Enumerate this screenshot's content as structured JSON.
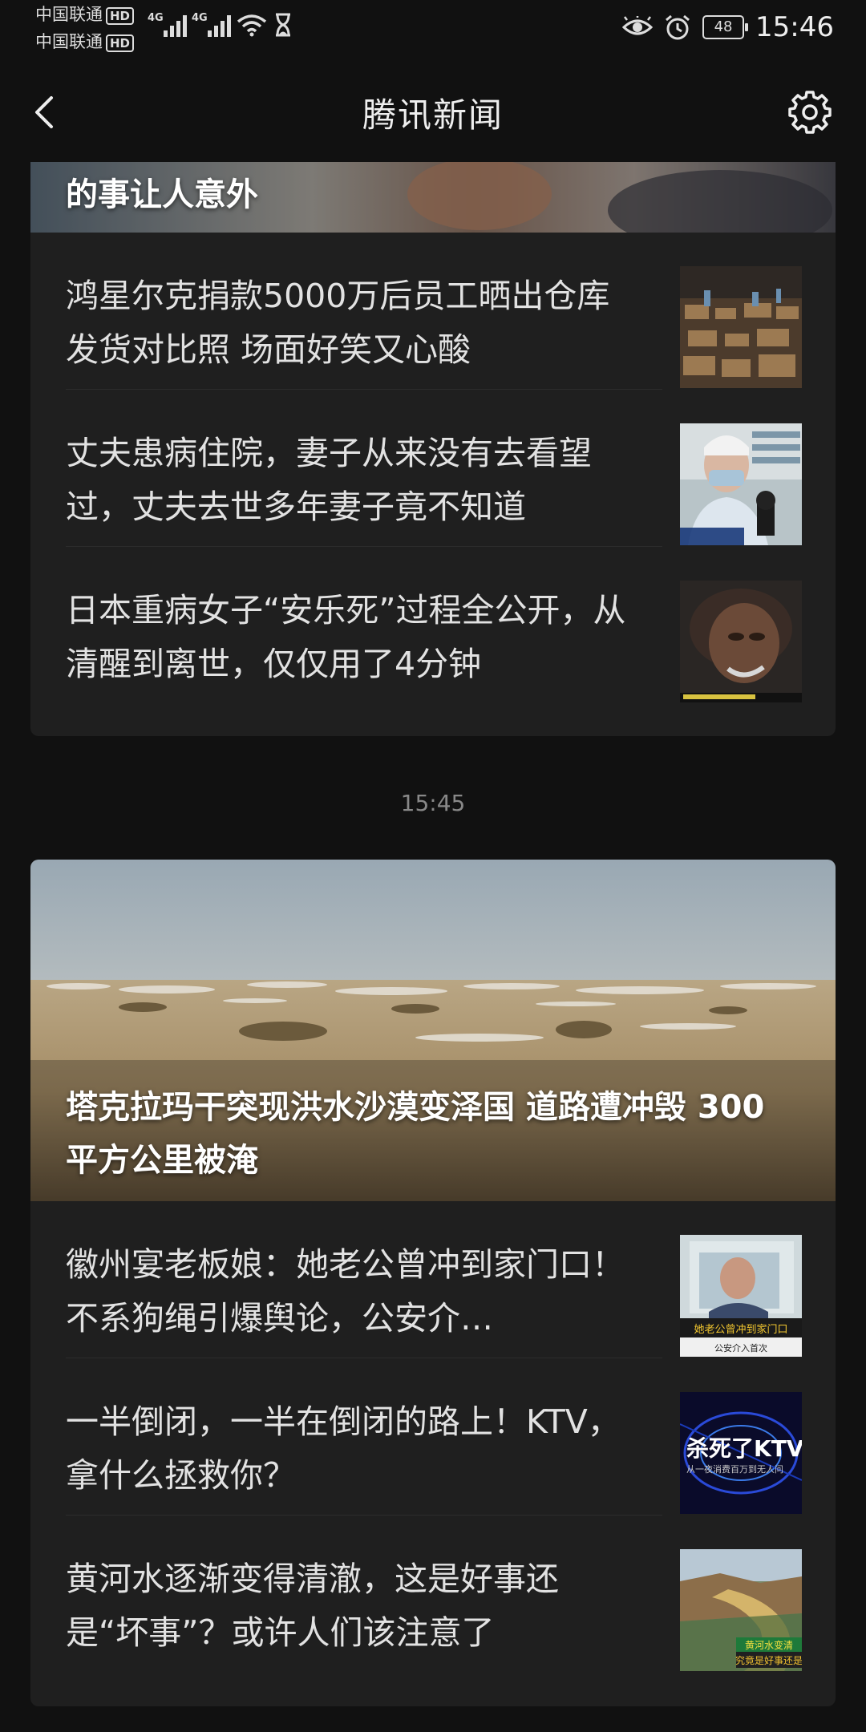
{
  "status_bar": {
    "carrier1": "中国联通",
    "carrier2": "中国联通",
    "hd": "HD",
    "network": "4G",
    "battery": "48",
    "time": "15:46"
  },
  "header": {
    "title": "腾讯新闻"
  },
  "card1": {
    "hero_title": "的事让人意外",
    "items": [
      {
        "text": "鸿星尔克捐款5000万后员工晒出仓库发货对比照 场面好笑又心酸"
      },
      {
        "text": "丈夫患病住院，妻子从来没有去看望过，丈夫去世多年妻子竟不知道"
      },
      {
        "text": "日本重病女子“安乐死”过程全公开，从清醒到离世，仅仅用了4分钟"
      }
    ]
  },
  "time_separator": "15:45",
  "card2": {
    "hero_title": "塔克拉玛干突现洪水沙漠变泽国 道路遭冲毁 300 平方公里被淹",
    "items": [
      {
        "text": "徽州宴老板娘：她老公曾冲到家门口！不系狗绳引爆舆论，公安介…"
      },
      {
        "text": "一半倒闭，一半在倒闭的路上！KTV，拿什么拯救你？"
      },
      {
        "text": "黄河水逐渐变得清澈，这是好事还是“坏事”？或许人们该注意了"
      }
    ]
  },
  "thumb_text": {
    "t4_caption": "她老公曾冲到家门口",
    "t4_sub": "公安介入首次",
    "t5_big": "杀死了KTV",
    "t5_sub": "从一夜消费百万到无人问",
    "t6_a": "黄河水变清",
    "t6_b": "究竟是好事还是"
  }
}
